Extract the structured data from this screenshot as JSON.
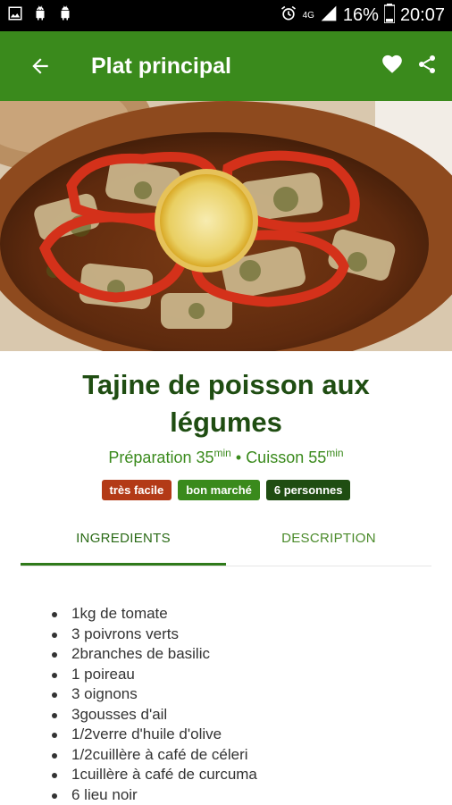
{
  "status_bar": {
    "network": "4G",
    "battery": "16%",
    "time": "20:07",
    "icons": [
      "image-icon",
      "android-icon",
      "android-icon",
      "alarm-icon",
      "signal-icon",
      "battery-icon"
    ]
  },
  "app_bar": {
    "title": "Plat principal",
    "icons": [
      "back-arrow-icon",
      "heart-icon",
      "share-icon"
    ],
    "color": "#3a8a1c"
  },
  "recipe": {
    "title": "Tajine de poisson aux légumes",
    "prep_label": "Préparation 35",
    "cook_label": "Cuisson 55",
    "unit": "min",
    "separator": "•",
    "badges": [
      {
        "label": "très facile",
        "color": "#b33a17"
      },
      {
        "label": "bon marché",
        "color": "#3a8a1c"
      },
      {
        "label": "6 personnes",
        "color": "#1f4d12"
      }
    ]
  },
  "tabs": [
    {
      "label": "INGREDIENTS",
      "active": true
    },
    {
      "label": "DESCRIPTION",
      "active": false
    }
  ],
  "ingredients": [
    "1kg de tomate",
    "3 poivrons verts",
    "2branches de basilic",
    "1 poireau",
    "3 oignons",
    "3gousses d'ail",
    "1/2verre d'huile d'olive",
    "1/2cuillère à café de céleri",
    "1cuillère à café de curcuma",
    "6 lieu noir"
  ]
}
